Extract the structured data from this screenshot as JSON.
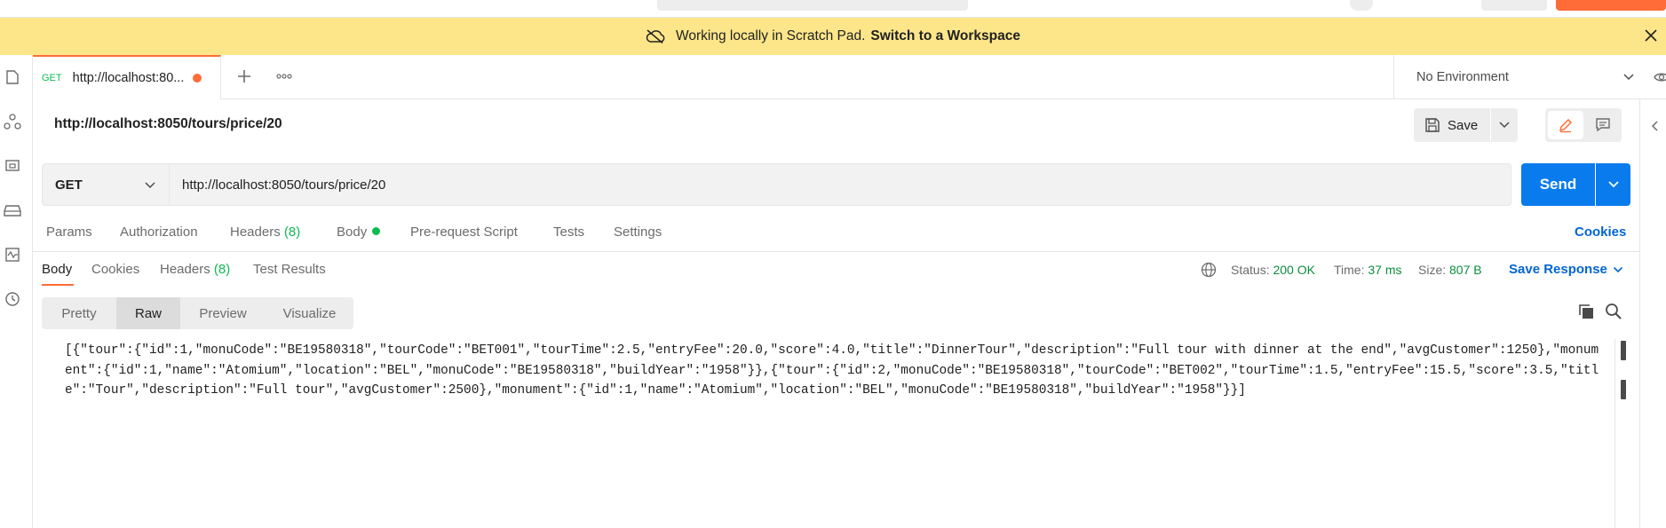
{
  "banner": {
    "text": "Working locally in Scratch Pad.",
    "link": "Switch to a Workspace"
  },
  "tabs": {
    "active": {
      "method": "GET",
      "label": "http://localhost:80..."
    }
  },
  "environment": {
    "selected": "No Environment"
  },
  "request": {
    "name": "http://localhost:8050/tours/price/20",
    "save_label": "Save",
    "method": "GET",
    "url": "http://localhost:8050/tours/price/20",
    "send_label": "Send"
  },
  "request_tabs": {
    "params": "Params",
    "authorization": "Authorization",
    "headers": "Headers",
    "headers_count": "(8)",
    "body": "Body",
    "pre_request": "Pre-request Script",
    "tests": "Tests",
    "settings": "Settings",
    "cookies": "Cookies"
  },
  "response_tabs": {
    "body": "Body",
    "cookies": "Cookies",
    "headers": "Headers",
    "headers_count": "(8)",
    "test_results": "Test Results"
  },
  "response_meta": {
    "status_label": "Status:",
    "status_value": "200 OK",
    "time_label": "Time:",
    "time_value": "37 ms",
    "size_label": "Size:",
    "size_value": "807 B",
    "save_response": "Save Response"
  },
  "view_modes": [
    "Pretty",
    "Raw",
    "Preview",
    "Visualize"
  ],
  "response_body": "[{\"tour\":{\"id\":1,\"monuCode\":\"BE19580318\",\"tourCode\":\"BET001\",\"tourTime\":2.5,\"entryFee\":20.0,\"score\":4.0,\"title\":\"DinnerTour\",\"description\":\"Full tour with dinner at the end\",\"avgCustomer\":1250},\"monument\":{\"id\":1,\"name\":\"Atomium\",\"location\":\"BEL\",\"monuCode\":\"BE19580318\",\"buildYear\":\"1958\"}},{\"tour\":{\"id\":2,\"monuCode\":\"BE19580318\",\"tourCode\":\"BET002\",\"tourTime\":1.5,\"entryFee\":15.5,\"score\":3.5,\"title\":\"Tour\",\"description\":\"Full tour\",\"avgCustomer\":2500},\"monument\":{\"id\":1,\"name\":\"Atomium\",\"location\":\"BEL\",\"monuCode\":\"BE19580318\",\"buildYear\":\"1958\"}}]",
  "colors": {
    "accent": "#ff6c37",
    "primary": "#097bed",
    "banner": "#fde68a",
    "success": "#0cbb52"
  }
}
